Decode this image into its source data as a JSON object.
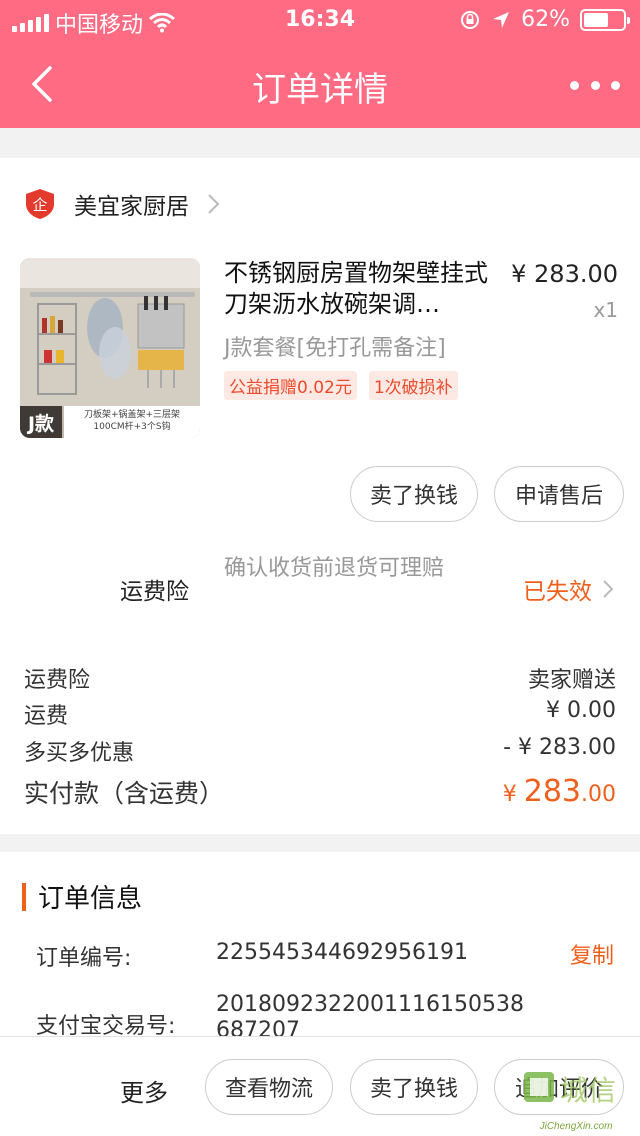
{
  "status_bar": {
    "carrier": "中国移动",
    "time": "16:34",
    "battery": "62%",
    "battery_level": 0.62
  },
  "nav": {
    "title": "订单详情",
    "back_icon": "chevron-left-icon",
    "more_icon": "more-dots-icon"
  },
  "shop": {
    "name": "美宜家厨居",
    "logo_text": "企"
  },
  "product": {
    "title": "不锈钢厨房置物架壁挂式刀架沥水放碗架调…",
    "price": "¥ 283.00",
    "qty": "x1",
    "spec": "J款套餐[免打孔需备注]",
    "tags": [
      "公益捐赠0.02元",
      "1次破损补"
    ],
    "thumb_badge": "J款",
    "thumb_caption_1": "刀板架+锅盖架+三层架",
    "thumb_caption_2": "100CM杆+3个S钩"
  },
  "item_actions": {
    "sell": "卖了换钱",
    "after_sale": "申请售后"
  },
  "insurance": {
    "label": "运费险",
    "desc": "确认收货前退货可理赔",
    "status": "已失效"
  },
  "fees": [
    {
      "label": "运费险",
      "value": "卖家赠送"
    },
    {
      "label": "运费",
      "value": "¥ 0.00"
    },
    {
      "label": "多买多优惠",
      "value": "- ¥ 283.00"
    }
  ],
  "total": {
    "label": "实付款（含运费）",
    "currency": "¥ ",
    "int": "283",
    "dec": ".00"
  },
  "order_info": {
    "title": "订单信息",
    "order_no_label": "订单编号:",
    "order_no": "2255453446929561​91",
    "copy": "复制",
    "alipay_label": "支付宝交易号:",
    "alipay_no_1": "20180923220011161505​38",
    "alipay_no_2": "687207"
  },
  "bottom": {
    "more": "更多",
    "logistics": "查看物流",
    "sell": "卖了换钱",
    "review": "追加评价"
  },
  "watermark": {
    "brand": "城信",
    "url": "JiChengXin.com"
  }
}
